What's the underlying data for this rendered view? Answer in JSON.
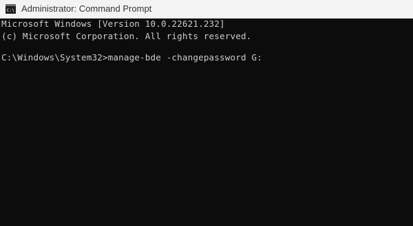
{
  "window": {
    "title": "Administrator: Command Prompt",
    "icon": "cmd-console-icon"
  },
  "console": {
    "lines": [
      "Microsoft Windows [Version 10.0.22621.232]",
      "(c) Microsoft Corporation. All rights reserved.",
      "",
      "C:\\Windows\\System32>manage-bde -changepassword G:"
    ]
  },
  "colors": {
    "titlebar_bg": "#f3f3f3",
    "console_bg": "#0c0c0c",
    "console_text": "#cccccc"
  }
}
